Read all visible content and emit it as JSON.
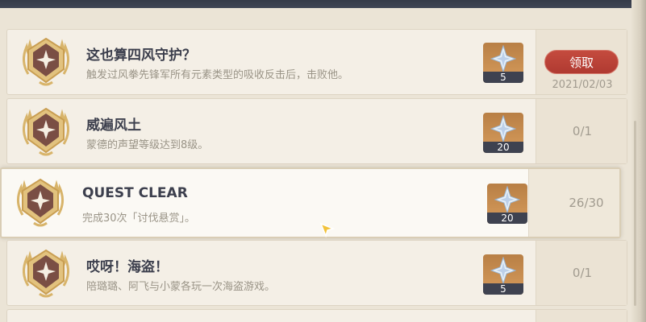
{
  "achievements": [
    {
      "title": "这也算四风守护？",
      "description": "触发过风拳先锋军所有元素类型的吸收反击后，击败他。",
      "reward_qty": "5",
      "status": "",
      "claim_label": "领取",
      "claim_date": "2021/02/03"
    },
    {
      "title": "威遍风土",
      "description": "蒙德的声望等级达到8级。",
      "reward_qty": "20",
      "status": "0/1"
    },
    {
      "title": "QUEST CLEAR",
      "description": "完成30次「讨伐悬赏」。",
      "reward_qty": "20",
      "status": "26/30"
    },
    {
      "title": "哎呀！海盗！",
      "description": "陪璐璐、阿飞与小蒙各玩一次海盗游戏。",
      "reward_qty": "5",
      "status": "0/1"
    }
  ],
  "colors": {
    "claim_button": "#b83f34",
    "reward_bg": "#c98c50",
    "row_bg": "#f4efe6"
  },
  "icons": {
    "medal": "achievement-medal-icon",
    "reward": "primogem-icon",
    "cursor": "cursor-icon"
  }
}
